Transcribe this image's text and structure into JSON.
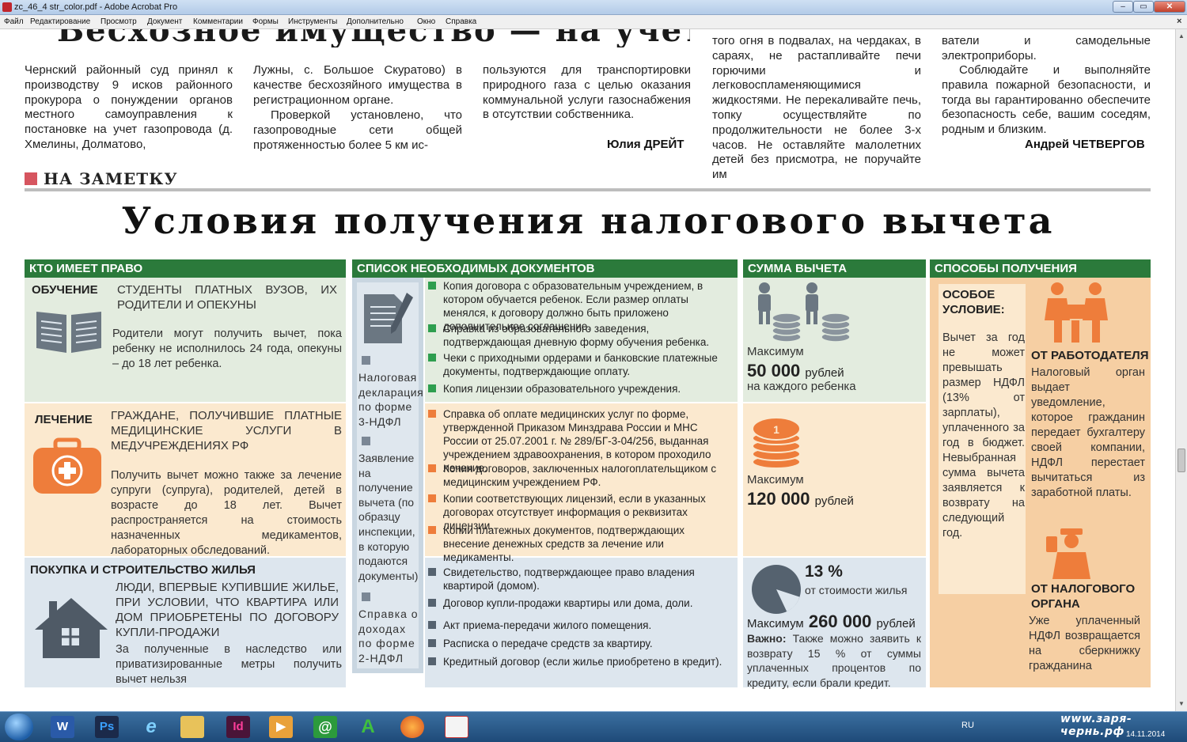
{
  "window": {
    "title": "zc_46_4 str_color.pdf - Adobe Acrobat Pro",
    "controls": {
      "minimize": "–",
      "maximize": "▭",
      "close": "✕"
    }
  },
  "menu": [
    "Файл",
    "Редактирование",
    "Просмотр",
    "Документ",
    "Комментарии",
    "Формы",
    "Инструменты",
    "Дополнительно",
    "Окно",
    "Справка"
  ],
  "menu_close": "×",
  "article_prev": {
    "headline": "Бесхозное имущество — на учет",
    "col1": "Чернский районный суд принял к производству 9 исков районного прокурора о понуждении органов местного самоуправления к постановке на учет газопровода (д. Хмелины, Долматово,",
    "col2a": "Лужны, с. Большое Скуратово) в качестве бесхозяйного имущества в регистрационном органе.",
    "col2b": "Проверкой установлено, что газопроводные сети общей протяженностью более 5 км ис-",
    "col3": "пользуются для транспортировки природного газа с целью оказания коммунальной услуги газоснабжения в отсутствии собственника.",
    "author1": "Юлия ДРЕЙТ"
  },
  "article_fire": {
    "col1": "того огня в подвалах, на чердаках, в сараях, не растапливайте печи горючими и легковоспламеняющимися жидкостями. Не перекаливайте печь, топку осуществляйте по продолжительности не более 3-х часов. Не оставляйте малолетних детей без присмотра, не поручайте им",
    "col2a": "ватели и самодельные электроприборы.",
    "col2b": "Соблюдайте и выполняйте правила пожарной безопасности, и тогда вы гарантированно обеспечите безопасность себе, вашим соседям, родным и близким.",
    "author2": "Андрей ЧЕТВЕРГОВ"
  },
  "section_label": "НА ЗАМЕТКУ",
  "main_title": "Условия получения налогового вычета",
  "headers": {
    "who": "КТО ИМЕЕТ ПРАВО",
    "docs": "СПИСОК НЕОБХОДИМЫХ ДОКУМЕНТОВ",
    "sum": "СУММА ВЫЧЕТА",
    "ways": "СПОСОБЫ ПОЛУЧЕНИЯ"
  },
  "education": {
    "label": "ОБУЧЕНИЕ",
    "who": "студенты платных вузов, их родители и опекуны",
    "desc": "Родители могут получить вычет, пока ребенку не исполнилось 24 года, опекуны – до 18 лет ребенка.",
    "docs": [
      "Копия договора с образовательным учреждением, в котором обучается ребенок. Если размер оплаты менялся, к договору должно быть приложено дополнительное соглашение.",
      "Справка из образовательного заведения, подтверждающая дневную форму обучения ребенка.",
      "Чеки с приходными ордерами и банковские платежные документы, подтверждающие оплату.",
      "Копия лицензии образовательного учреждения."
    ],
    "sum_label": "Максимум",
    "sum_value": "50 000",
    "sum_unit": "рублей",
    "sum_note": "на каждого ребенка"
  },
  "treatment": {
    "label": "ЛЕЧЕНИЕ",
    "who": "граждане, получившие платные медицинские услуги в медучреждениях РФ",
    "desc": "Получить вычет можно также за лечение супруги (супруга), родителей, детей в возрасте до 18 лет. Вычет распространяется на стоимость назначенных медикаментов, лабораторных обследований.",
    "docs": [
      "Справка об оплате медицинских услуг по форме, утвержденной Приказом Минздрава России и МНС России от 25.07.2001 г. № 289/БГ-3-04/256, выданная учреждением здравоохранения, в котором проходило лечение.",
      "Копия договоров, заключенных налогоплательщиком с медицинским учреждением РФ.",
      "Копии соответствующих лицензий, если в указанных договорах отсутствует информация о реквизитах лицензии.",
      "Копии платежных документов, подтверждающих внесение денежных средств за лечение или медикаменты."
    ],
    "sum_label": "Максимум",
    "sum_value": "120 000",
    "sum_unit": "рублей"
  },
  "housing": {
    "label": "ПОКУПКА И СТРОИТЕЛЬСТВО ЖИЛЬЯ",
    "who": "люди, впервые купившие жилье, при условии, что квартира или дом приобретены по договору купли-продажи",
    "desc": "За полученные в наследство или приватизированные метры получить вычет нельзя",
    "docs": [
      "Свидетельство, подтверждающее право владения квартирой (домом).",
      "Договор купли-продажи квартиры или дома, доли.",
      "Акт приема-передачи жилого помещения.",
      "Расписка о передаче средств за квартиру.",
      "Кредитный договор (если жилье приобретено в кредит)."
    ],
    "percent": "13 %",
    "percent_note": "от стоимости жилья",
    "percent_fraction": 0.13,
    "sum_label": "Максимум",
    "sum_value": "260 000",
    "sum_unit": "рублей",
    "important_label": "Важно:",
    "important": "Также можно заявить к возврату 15 % от суммы уплаченных процентов по кредиту, если брали кредит."
  },
  "common_docs": {
    "d1": "Налоговая декларация по форме 3-НДФЛ",
    "d2": "Заявление на получение вычета (по образцу инспекции, в которую подаются документы)",
    "d3": "Справка о доходах по форме 2-НДФЛ"
  },
  "special": {
    "title": "ОСОБОЕ УСЛОВИЕ:",
    "text": "Вычет за год не может превышать размер НДФЛ (13% от зарплаты), уплаченного за год в бюджет. Невыбранная сумма вычета заявляется к возврату на следующий год."
  },
  "employer": {
    "title": "ОТ РАБОТОДАТЕЛЯ",
    "text": "Налоговый орган выдает уведомление, которое гражданин передает бухгалтеру своей компании, НДФЛ перестает вычитаться из заработной платы."
  },
  "tax_office": {
    "title": "ОТ НАЛОГОВОГО ОРГАНА",
    "text": "Уже уплаченный НДФЛ возвращается на сберкнижку гражданина"
  },
  "taskbar": {
    "apps": [
      "W",
      "Ps",
      "e",
      "Id",
      "@",
      "A"
    ],
    "lang": "RU",
    "watermark": "www.заря-чернь.рф",
    "date": "14.11.2014"
  },
  "colors": {
    "header_green": "#2b7a3b",
    "green_bullet": "#2e9e4f",
    "orange_bullet": "#ee7d3b",
    "slate_bullet": "#55626f",
    "orange_panel": "#f6cfa3"
  }
}
